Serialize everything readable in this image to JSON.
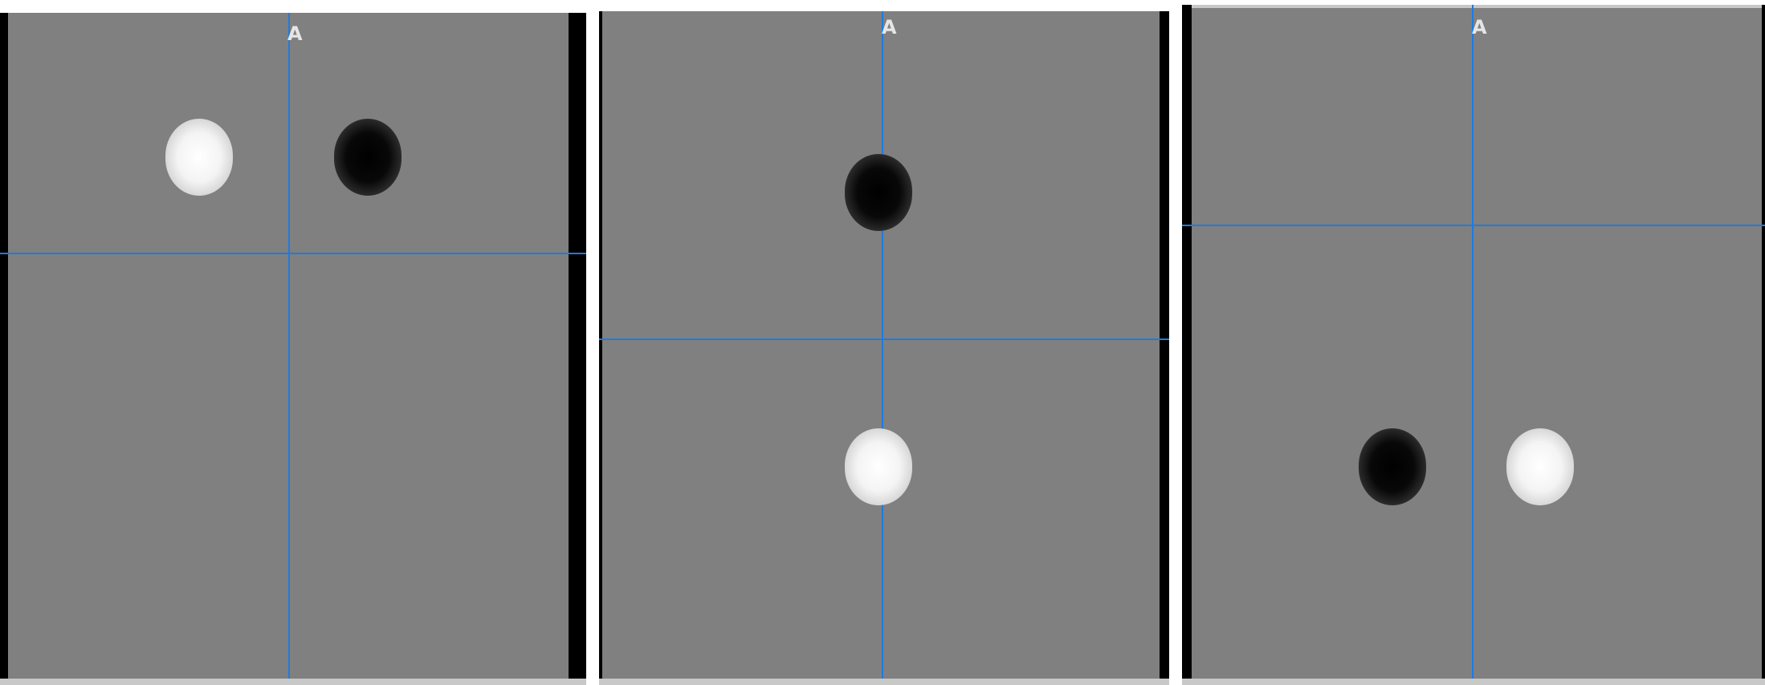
{
  "viewports": [
    {
      "name": "view-1",
      "orientation_label": "A",
      "blobs": [
        "white",
        "black"
      ]
    },
    {
      "name": "view-2",
      "orientation_label": "A",
      "blobs": [
        "black",
        "white"
      ]
    },
    {
      "name": "view-3",
      "orientation_label": "A",
      "blobs": [
        "black",
        "white"
      ]
    }
  ],
  "colors": {
    "crosshair": "#1e7be0",
    "background": "#808080",
    "label": "#e6e6e6"
  }
}
